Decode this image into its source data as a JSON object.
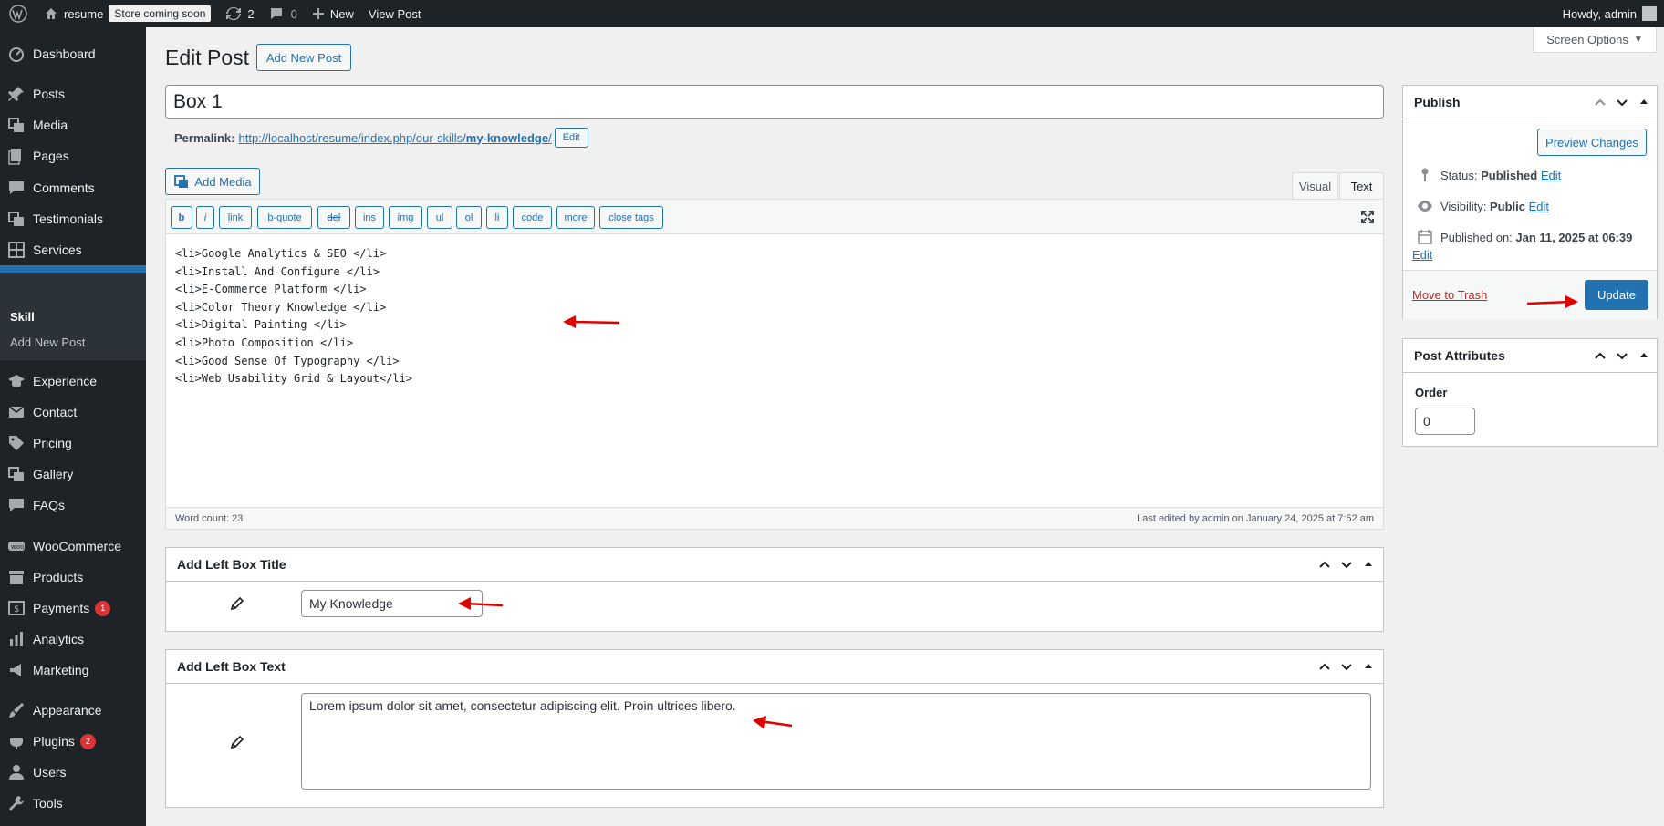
{
  "adminbar": {
    "site_name": "resume",
    "store_badge": "Store coming soon",
    "updates_count": "2",
    "comments_count": "0",
    "new_label": "New",
    "view_post_label": "View Post",
    "howdy": "Howdy, admin"
  },
  "menu": {
    "items": [
      {
        "label": "Dashboard",
        "icon": "dashboard-icon"
      },
      {
        "label": "Posts",
        "icon": "pin-icon"
      },
      {
        "label": "Media",
        "icon": "media-icon"
      },
      {
        "label": "Pages",
        "icon": "pages-icon"
      },
      {
        "label": "Comments",
        "icon": "comments-icon"
      },
      {
        "label": "Testimonials",
        "icon": "media-icon"
      },
      {
        "label": "Services",
        "icon": "grid-icon"
      },
      {
        "label": "Skill",
        "icon": "list-icon"
      },
      {
        "label": "Experience",
        "icon": "education-icon"
      },
      {
        "label": "Contact",
        "icon": "email-icon"
      },
      {
        "label": "Pricing",
        "icon": "tag-icon"
      },
      {
        "label": "Gallery",
        "icon": "media-icon"
      },
      {
        "label": "FAQs",
        "icon": "comments-icon"
      },
      {
        "label": "WooCommerce",
        "icon": "woo-icon"
      },
      {
        "label": "Products",
        "icon": "archive-icon"
      },
      {
        "label": "Payments",
        "icon": "dollar-icon",
        "badge": "1"
      },
      {
        "label": "Analytics",
        "icon": "chart-icon"
      },
      {
        "label": "Marketing",
        "icon": "megaphone-icon"
      },
      {
        "label": "Appearance",
        "icon": "brush-icon"
      },
      {
        "label": "Plugins",
        "icon": "plugin-icon",
        "badge": "2"
      },
      {
        "label": "Users",
        "icon": "users-icon"
      },
      {
        "label": "Tools",
        "icon": "wrench-icon"
      }
    ],
    "submenu": [
      "Skill",
      "Add New Post"
    ]
  },
  "page": {
    "title": "Edit Post",
    "add_new_label": "Add New Post",
    "screen_options": "Screen Options"
  },
  "post": {
    "title": "Box 1",
    "permalink_label": "Permalink:",
    "permalink_base": "http://localhost/resume/index.php/our-skills/",
    "permalink_slug": "my-knowledge",
    "permalink_edit": "Edit"
  },
  "editor": {
    "add_media": "Add Media",
    "tab_visual": "Visual",
    "tab_text": "Text",
    "toolbar": [
      "b",
      "i",
      "link",
      "b-quote",
      "del",
      "ins",
      "img",
      "ul",
      "ol",
      "li",
      "code",
      "more",
      "close tags"
    ],
    "content": "<li>Google Analytics & SEO </li>\n<li>Install And Configure </li>\n<li>E-Commerce Platform </li>\n<li>Color Theory Knowledge </li>\n<li>Digital Painting </li>\n<li>Photo Composition </li>\n<li>Good Sense Of Typography </li>\n<li>Web Usability Grid & Layout</li>",
    "word_count": "Word count: 23",
    "last_edited": "Last edited by admin on January 24, 2025 at 7:52 am"
  },
  "left_box_title": {
    "header": "Add Left Box Title",
    "value": "My Knowledge"
  },
  "left_box_text": {
    "header": "Add Left Box Text",
    "value": "Lorem ipsum dolor sit amet, consectetur adipiscing elit. Proin ultrices libero."
  },
  "publish": {
    "header": "Publish",
    "preview": "Preview Changes",
    "status_label": "Status:",
    "status_value": "Published",
    "visibility_label": "Visibility:",
    "visibility_value": "Public",
    "published_label": "Published on:",
    "published_value": "Jan 11, 2025 at 06:39",
    "edit": "Edit",
    "trash": "Move to Trash",
    "update": "Update"
  },
  "attributes": {
    "header": "Post Attributes",
    "order_label": "Order",
    "order_value": "0"
  },
  "colors": {
    "admin_bar": "#1d2327",
    "accent": "#2271b1",
    "annotation_arrow": "#e00000",
    "badge": "#d63638"
  }
}
